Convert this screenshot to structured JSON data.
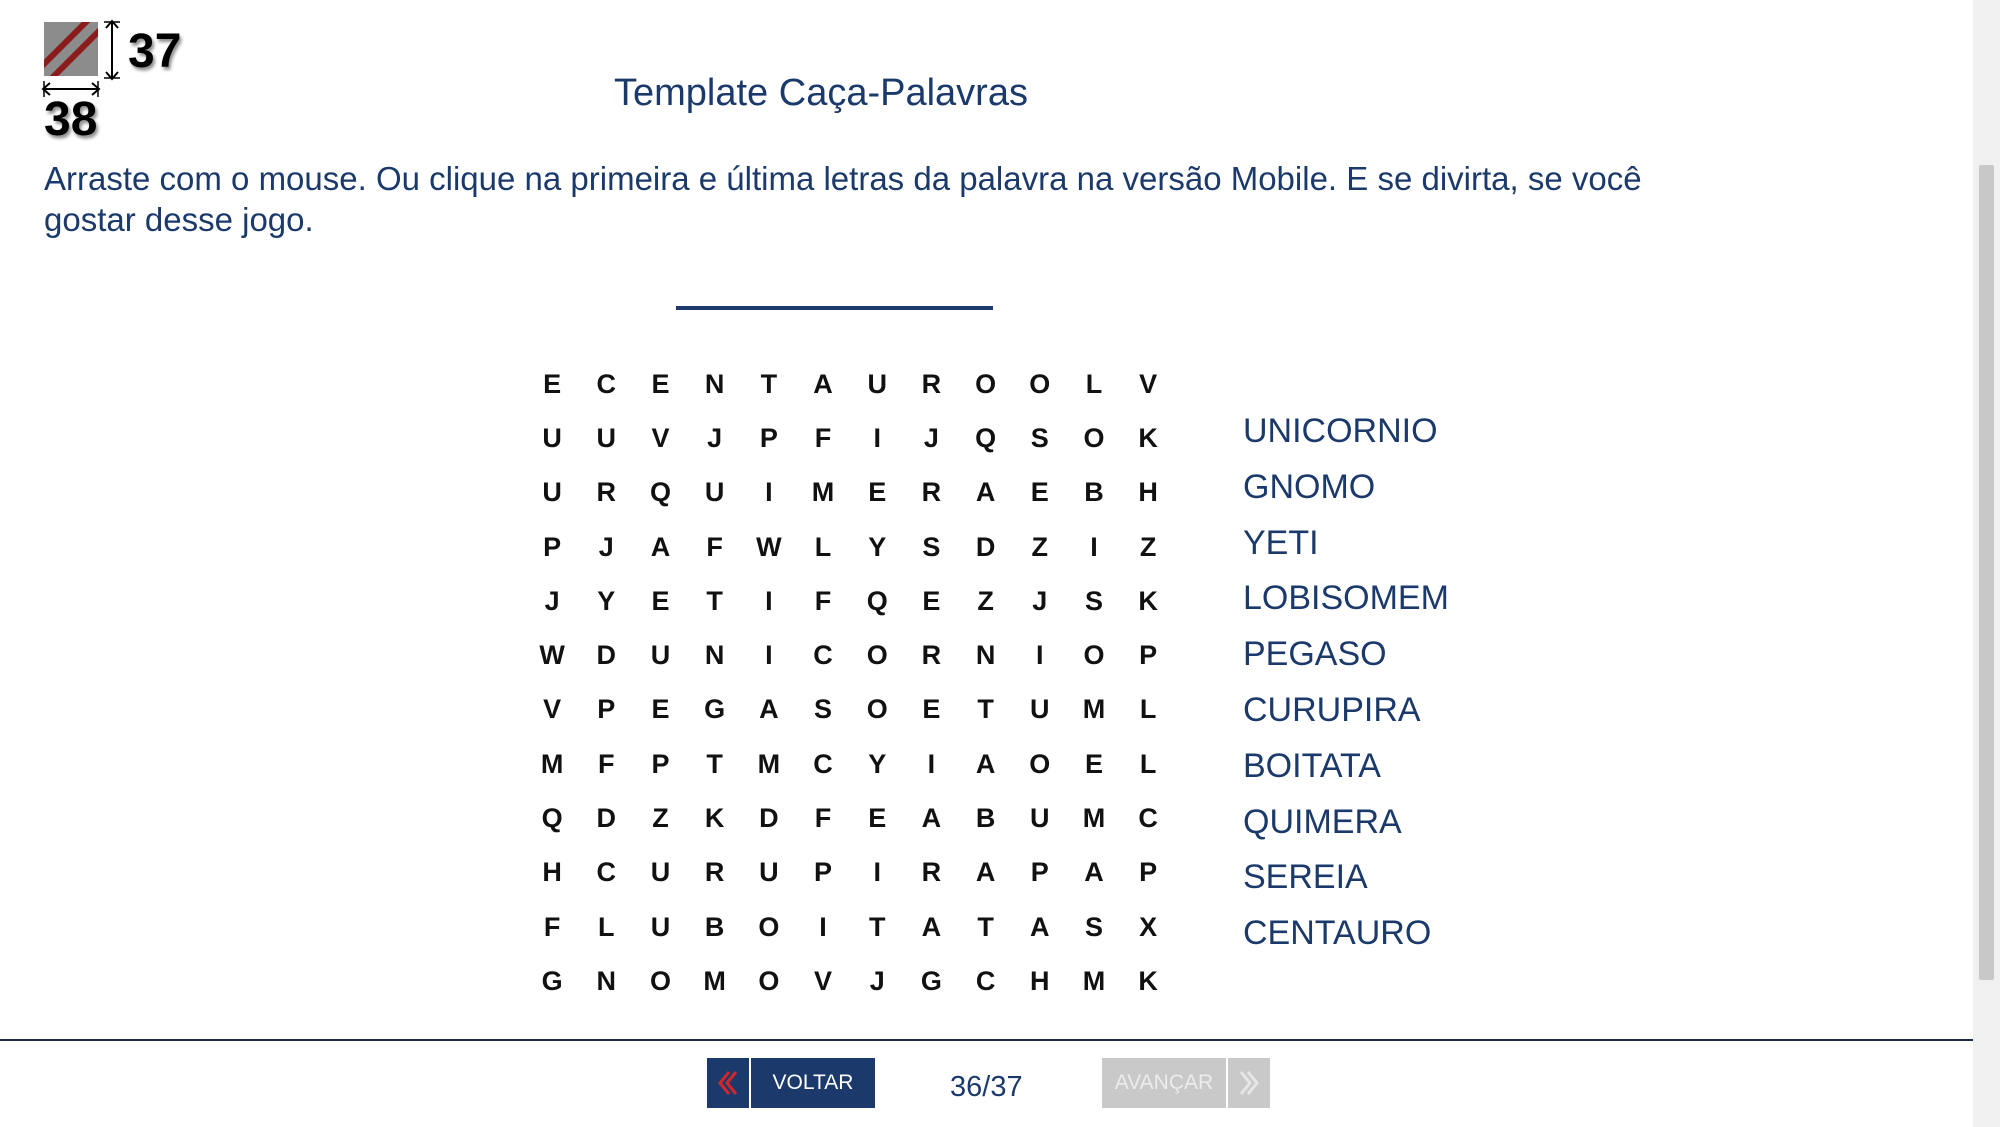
{
  "dimension_widget": {
    "width_value": "38",
    "height_value": "37"
  },
  "title": "Template Caça-Palavras",
  "instructions": "Arraste com o mouse. Ou clique na primeira e última letras da palavra na versão Mobile. E se divirta, se você gostar desse jogo.",
  "grid": [
    [
      "E",
      "C",
      "E",
      "N",
      "T",
      "A",
      "U",
      "R",
      "O",
      "O",
      "L",
      "V"
    ],
    [
      "U",
      "U",
      "V",
      "J",
      "P",
      "F",
      "I",
      "J",
      "Q",
      "S",
      "O",
      "K"
    ],
    [
      "U",
      "R",
      "Q",
      "U",
      "I",
      "M",
      "E",
      "R",
      "A",
      "E",
      "B",
      "H"
    ],
    [
      "P",
      "J",
      "A",
      "F",
      "W",
      "L",
      "Y",
      "S",
      "D",
      "Z",
      "I",
      "Z"
    ],
    [
      "J",
      "Y",
      "E",
      "T",
      "I",
      "F",
      "Q",
      "E",
      "Z",
      "J",
      "S",
      "K"
    ],
    [
      "W",
      "D",
      "U",
      "N",
      "I",
      "C",
      "O",
      "R",
      "N",
      "I",
      "O",
      "P"
    ],
    [
      "V",
      "P",
      "E",
      "G",
      "A",
      "S",
      "O",
      "E",
      "T",
      "U",
      "M",
      "L"
    ],
    [
      "M",
      "F",
      "P",
      "T",
      "M",
      "C",
      "Y",
      "I",
      "A",
      "O",
      "E",
      "L"
    ],
    [
      "Q",
      "D",
      "Z",
      "K",
      "D",
      "F",
      "E",
      "A",
      "B",
      "U",
      "M",
      "C"
    ],
    [
      "H",
      "C",
      "U",
      "R",
      "U",
      "P",
      "I",
      "R",
      "A",
      "P",
      "A",
      "P"
    ],
    [
      "F",
      "L",
      "U",
      "B",
      "O",
      "I",
      "T",
      "A",
      "T",
      "A",
      "S",
      "X"
    ],
    [
      "G",
      "N",
      "O",
      "M",
      "O",
      "V",
      "J",
      "G",
      "C",
      "H",
      "M",
      "K"
    ]
  ],
  "words": [
    "UNICORNIO",
    "GNOMO",
    "YETI",
    "LOBISOMEM",
    "PEGASO",
    "CURUPIRA",
    "BOITATA",
    "QUIMERA",
    "SEREIA",
    "CENTAURO"
  ],
  "footer": {
    "back_label": "VOLTAR",
    "page_counter": "36/37",
    "next_label": "AVANÇAR"
  },
  "icons": {
    "back": "chevron-double-left-icon",
    "next": "chevron-double-right-icon",
    "dimension": "texture-swatch-icon"
  },
  "colors": {
    "primary": "#1b3a6b",
    "accent_red": "#d3262b",
    "disabled": "#c9c9c9"
  }
}
